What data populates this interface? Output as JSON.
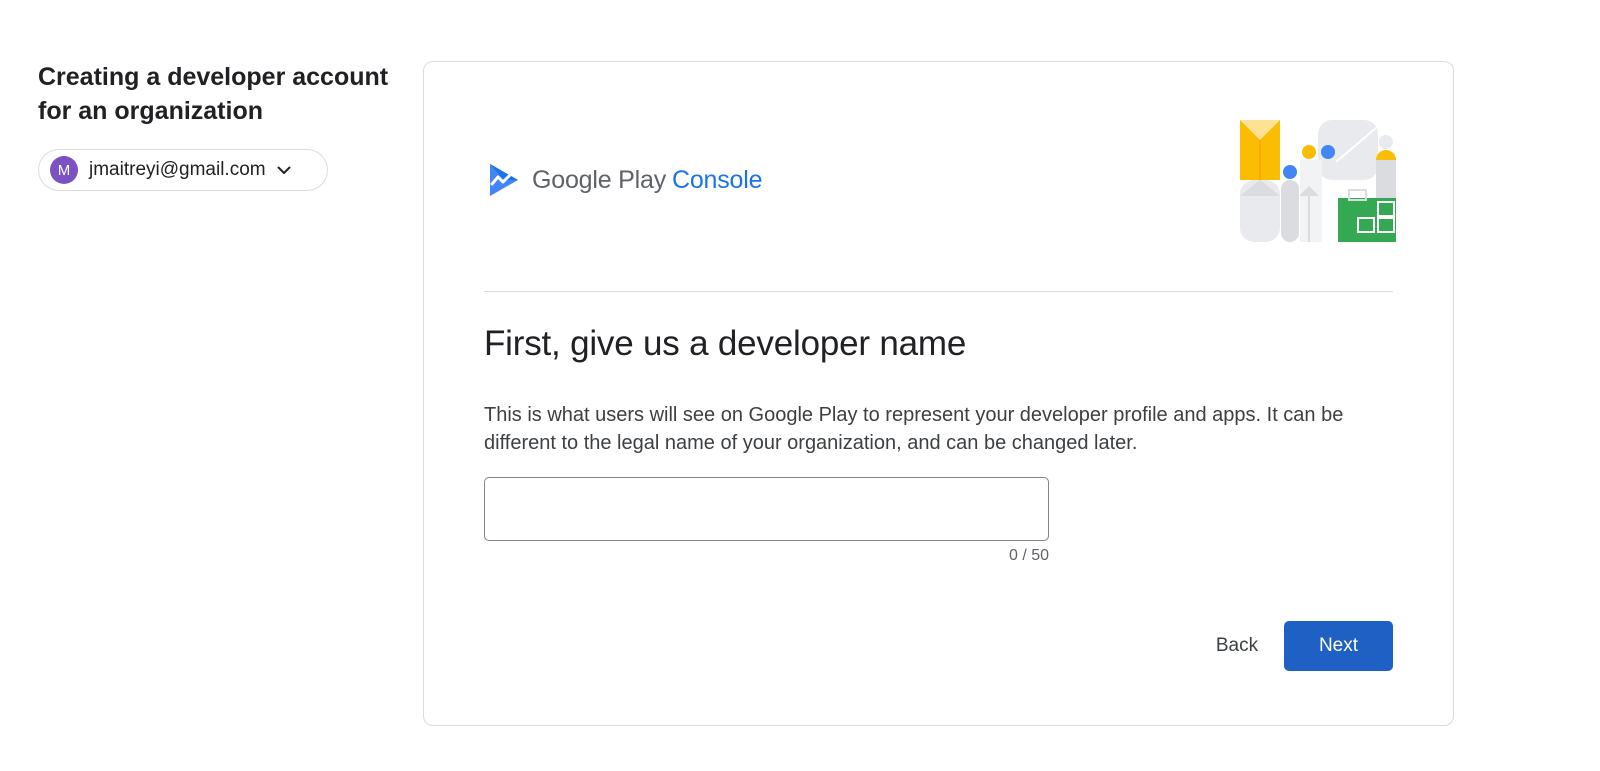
{
  "sidebar": {
    "title": "Creating a developer account for an organization",
    "account": {
      "avatar_letter": "M",
      "avatar_color": "#7b52c4",
      "email": "jmaitreyi@gmail.com",
      "dropdown_icon": "chevron-down-icon"
    }
  },
  "card": {
    "brand": {
      "logo_icon": "play-console-logo",
      "name": "Google Play",
      "product": "Console"
    },
    "illustration_icon": "people-shapes-illustration",
    "heading": "First, give us a developer name",
    "description": "This is what users will see on Google Play to represent your developer profile and apps. It can be different to the legal name of your organization, and can be changed later.",
    "developer_name_input": {
      "value": "",
      "placeholder": ""
    },
    "char_counter": "0 / 50",
    "actions": {
      "back_label": "Back",
      "next_label": "Next"
    }
  },
  "colors": {
    "primary_button": "#1f60c4",
    "brand_blue": "#1a73e8",
    "border": "#dadce0"
  }
}
